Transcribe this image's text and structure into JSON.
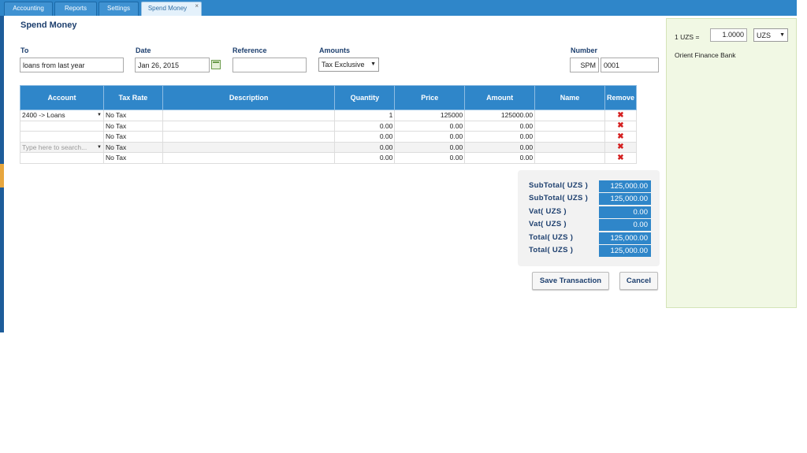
{
  "tabs": [
    {
      "label": "Accounting"
    },
    {
      "label": "Reports"
    },
    {
      "label": "Settings"
    },
    {
      "label": "Spend Money",
      "close": "×"
    }
  ],
  "page_title": "Spend Money",
  "form": {
    "to_label": "To",
    "to_value": "loans from last year",
    "date_label": "Date",
    "date_value": "Jan 26, 2015",
    "reference_label": "Reference",
    "reference_value": "",
    "amounts_label": "Amounts",
    "amounts_value": "Tax Exclusive",
    "number_label": "Number",
    "number_prefix": "SPM",
    "number_value": "0001"
  },
  "table": {
    "headers": [
      "Account",
      "Tax Rate",
      "Description",
      "Quantity",
      "Price",
      "Amount",
      "Name",
      "Remove"
    ],
    "rows": [
      {
        "account": "2400 -> Loans",
        "tax": "No Tax",
        "description": "",
        "quantity": "1",
        "price": "125000",
        "amount": "125000.00",
        "name": "",
        "remove": "✖"
      },
      {
        "account": "",
        "tax": "No Tax",
        "description": "",
        "quantity": "0.00",
        "price": "0.00",
        "amount": "0.00",
        "name": "",
        "remove": "✖"
      },
      {
        "account": "",
        "tax": "No Tax",
        "description": "",
        "quantity": "0.00",
        "price": "0.00",
        "amount": "0.00",
        "name": "",
        "remove": "✖"
      },
      {
        "account": "Type here to search...",
        "tax": "No Tax",
        "description": "",
        "quantity": "0.00",
        "price": "0.00",
        "amount": "0.00",
        "name": "",
        "remove": "✖"
      },
      {
        "account": "",
        "tax": "No Tax",
        "description": "",
        "quantity": "0.00",
        "price": "0.00",
        "amount": "0.00",
        "name": "",
        "remove": "✖"
      }
    ]
  },
  "totals": [
    {
      "label": "SubTotal( UZS )",
      "value": "125,000.00"
    },
    {
      "label": "SubTotal( UZS )",
      "value": "125,000.00"
    },
    {
      "label": "Vat( UZS )",
      "value": "0.00"
    },
    {
      "label": "Vat( UZS )",
      "value": "0.00"
    },
    {
      "label": "Total( UZS )",
      "value": "125,000.00"
    },
    {
      "label": "Total( UZS )",
      "value": "125,000.00"
    }
  ],
  "buttons": {
    "save": "Save Transaction",
    "cancel": "Cancel"
  },
  "currency": {
    "label": "1 UZS =",
    "rate": "1.0000",
    "code": "UZS"
  },
  "bank_name": "Orient Finance Bank",
  "colors": {
    "accent": "#2f86c9",
    "remove": "#d42020",
    "panel": "#f1f8e4"
  }
}
